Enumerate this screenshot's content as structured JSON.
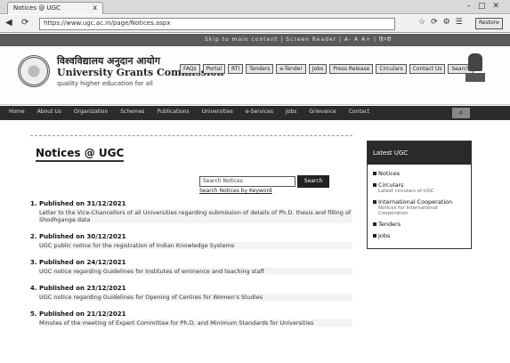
{
  "browser": {
    "tab_title": "Notices @ UGC",
    "tab_close": "x",
    "url": "https://www.ugc.ac.in/page/Notices.aspx",
    "profile": "Restore"
  },
  "site": {
    "title_hindi": "विश्वविद्यालय अनुदान आयोग",
    "title_english": "University Grants Commission",
    "subtitle": "quality higher education for all",
    "quick_links": [
      "FAQs",
      "Portal",
      "RTI",
      "Tenders",
      "e-Tender",
      "Jobs",
      "Press Release",
      "Circulars",
      "Contact Us",
      "Search"
    ],
    "top_links": "Skip to main content | Screen Reader | A- A A+ | हिन्दी",
    "nav_items": [
      "Home",
      "About Us",
      "Organization",
      "Schemes",
      "Publications",
      "Universities",
      "e-Services",
      "Jobs",
      "Grievance",
      "Contact"
    ]
  },
  "content": {
    "page_title": "Notices @ UGC",
    "search_placeholder": "Search Notices",
    "search_button": "Search",
    "search_hint": "Search Notices by Keyword",
    "notices": [
      {
        "date": "1. Published on 31/12/2021",
        "text": "Letter to the Vice-Chancellors of all Universities regarding submission of details of Ph.D. thesis and filling of Shodhganga data"
      },
      {
        "date": "2. Published on 30/12/2021",
        "text": "UGC public notice for the registration of Indian Knowledge Systems"
      },
      {
        "date": "3. Published on 24/12/2021",
        "text": "UGC notice regarding Guidelines for Institutes of eminence and teaching staff"
      },
      {
        "date": "4. Published on 23/12/2021",
        "text": "UGC notice regarding Guidelines for Opening of Centres for Women's Studies"
      },
      {
        "date": "5. Published on 21/12/2021",
        "text": "Minutes of the meeting of Expert Committee for Ph.D. and Minimum Standards for Universities"
      }
    ]
  },
  "sidebar": {
    "title": "Latest UGC",
    "items": [
      {
        "label": "Notices",
        "sub": ""
      },
      {
        "label": "Circulars",
        "sub": "Latest circulars of UGC"
      },
      {
        "label": "International Cooperation",
        "sub": "Notices for International Cooperation"
      },
      {
        "label": "Tenders",
        "sub": ""
      },
      {
        "label": "Jobs",
        "sub": ""
      }
    ]
  }
}
